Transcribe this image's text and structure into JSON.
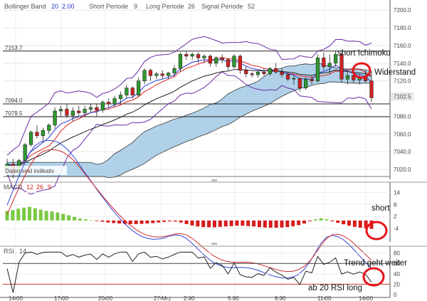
{
  "chart_data": [
    {
      "type": "candlestick",
      "indicators_title": {
        "bollinger_label": "Bollinger Band",
        "bollinger_p1": "20",
        "bollinger_p2": "2.00",
        "short_label": "Short Periode",
        "short_val": "9",
        "long_label": "Long Periode",
        "long_val": "26",
        "signal_label": "Signal Periode",
        "signal_val": "52"
      },
      "y_ticks": [
        "7200.0",
        "7180.0",
        "7160.0",
        "7140.0",
        "7120.0",
        "7102.5",
        "7080.0",
        "7060.0",
        "7040.0",
        "7020.0"
      ],
      "ylim": [
        7012,
        7205
      ],
      "levels": [
        {
          "label": "7153.7",
          "value": 7153.7
        },
        {
          "label": "7094.0",
          "value": 7094.0
        },
        {
          "label": "7079.5",
          "value": 7079.5
        }
      ],
      "last_price_label": "7102.5",
      "x_ticks": [
        "14:00",
        "17:00",
        "20:00",
        "27 Mrz",
        "2:00",
        "5:00",
        "8:00",
        "11:00",
        "14:00"
      ],
      "watermark": "Daten sind indikativ",
      "annotations": {
        "short_ichimoku": "short Ichimoku",
        "widerstand": "Widerstand"
      },
      "candles": [
        [
          7020,
          7032,
          7016,
          7026
        ],
        [
          7026,
          7032,
          7010,
          7014
        ],
        [
          7014,
          7032,
          7012,
          7030
        ],
        [
          7030,
          7050,
          7028,
          7048
        ],
        [
          7048,
          7064,
          7046,
          7062
        ],
        [
          7062,
          7070,
          7055,
          7058
        ],
        [
          7058,
          7067,
          7050,
          7064
        ],
        [
          7064,
          7072,
          7060,
          7070
        ],
        [
          7070,
          7090,
          7066,
          7086
        ],
        [
          7086,
          7092,
          7080,
          7088
        ],
        [
          7088,
          7094,
          7078,
          7081
        ],
        [
          7081,
          7090,
          7074,
          7086
        ],
        [
          7086,
          7092,
          7080,
          7084
        ],
        [
          7084,
          7092,
          7080,
          7088
        ],
        [
          7088,
          7094,
          7084,
          7090
        ],
        [
          7090,
          7094,
          7080,
          7087
        ],
        [
          7087,
          7098,
          7084,
          7096
        ],
        [
          7096,
          7100,
          7090,
          7094
        ],
        [
          7094,
          7103,
          7090,
          7100
        ],
        [
          7100,
          7108,
          7094,
          7104
        ],
        [
          7104,
          7116,
          7100,
          7112
        ],
        [
          7112,
          7114,
          7100,
          7104
        ],
        [
          7104,
          7124,
          7102,
          7120
        ],
        [
          7120,
          7134,
          7116,
          7132
        ],
        [
          7132,
          7134,
          7120,
          7126
        ],
        [
          7126,
          7130,
          7122,
          7128
        ],
        [
          7128,
          7132,
          7122,
          7126
        ],
        [
          7126,
          7130,
          7122,
          7129
        ],
        [
          7129,
          7138,
          7124,
          7134
        ],
        [
          7134,
          7152,
          7130,
          7150
        ],
        [
          7150,
          7154,
          7144,
          7148
        ],
        [
          7148,
          7152,
          7144,
          7150
        ],
        [
          7150,
          7152,
          7140,
          7146
        ],
        [
          7146,
          7150,
          7140,
          7148
        ],
        [
          7148,
          7150,
          7136,
          7140
        ],
        [
          7140,
          7148,
          7136,
          7146
        ],
        [
          7146,
          7150,
          7140,
          7144
        ],
        [
          7144,
          7146,
          7132,
          7136
        ],
        [
          7136,
          7150,
          7134,
          7148
        ],
        [
          7148,
          7150,
          7128,
          7132
        ],
        [
          7132,
          7136,
          7124,
          7128
        ],
        [
          7128,
          7130,
          7124,
          7127
        ],
        [
          7127,
          7132,
          7124,
          7130
        ],
        [
          7130,
          7134,
          7126,
          7128
        ],
        [
          7128,
          7136,
          7126,
          7134
        ],
        [
          7134,
          7140,
          7128,
          7130
        ],
        [
          7130,
          7134,
          7124,
          7127
        ],
        [
          7127,
          7130,
          7120,
          7122
        ],
        [
          7122,
          7126,
          7116,
          7123
        ],
        [
          7123,
          7124,
          7108,
          7112
        ],
        [
          7112,
          7124,
          7110,
          7122
        ],
        [
          7122,
          7126,
          7116,
          7120
        ],
        [
          7120,
          7150,
          7118,
          7146
        ],
        [
          7146,
          7152,
          7132,
          7136
        ],
        [
          7136,
          7150,
          7128,
          7140
        ],
        [
          7140,
          7154,
          7136,
          7150
        ],
        [
          7150,
          7152,
          7118,
          7122
        ],
        [
          7122,
          7130,
          7116,
          7126
        ],
        [
          7126,
          7134,
          7118,
          7121
        ],
        [
          7121,
          7128,
          7116,
          7124
        ],
        [
          7124,
          7132,
          7118,
          7120
        ],
        [
          7120,
          7122,
          7096,
          7101
        ]
      ]
    },
    {
      "type": "line",
      "title": "MACD",
      "params": [
        "12",
        "26",
        "9"
      ],
      "y_ticks": [
        "14",
        "8",
        "2",
        "-4"
      ],
      "ylim": [
        -10,
        17
      ],
      "annotation": "short",
      "histogram": [
        4.8,
        5.2,
        5.9,
        6.4,
        6.8,
        6.1,
        5.4,
        4.8,
        4.5,
        4.0,
        3.3,
        2.6,
        1.8,
        1.0,
        0.6,
        0.2,
        -0.3,
        -0.6,
        -1.0,
        -1.3,
        -1.5,
        -1.7,
        -1.8,
        -1.8,
        -1.7,
        -1.5,
        -1.3,
        -1.0,
        -0.7,
        -0.4,
        -0.5,
        -1.0,
        -1.8,
        -2.5,
        -3.0,
        -3.3,
        -3.4,
        -3.4,
        -3.2,
        -3.0,
        -2.8,
        -2.6,
        -2.6,
        -2.8,
        -3.0,
        -3.3,
        -3.5,
        -3.6,
        -3.6,
        -3.5,
        -3.3,
        -2.9,
        -2.3,
        -1.5,
        -0.4,
        0.6,
        1.1,
        0.6,
        -0.4,
        -1.2,
        -1.9,
        -2.6,
        -3.2,
        -3.6,
        -3.9,
        -4.2
      ]
    },
    {
      "type": "line",
      "title": "RSI",
      "param": "14",
      "y_ticks": [
        "80",
        "60",
        "40",
        "20",
        "0"
      ],
      "ylim": [
        0,
        85
      ],
      "annotations": {
        "trend": "Trend geht weiter",
        "long": "ab 20 RSI long"
      }
    }
  ]
}
